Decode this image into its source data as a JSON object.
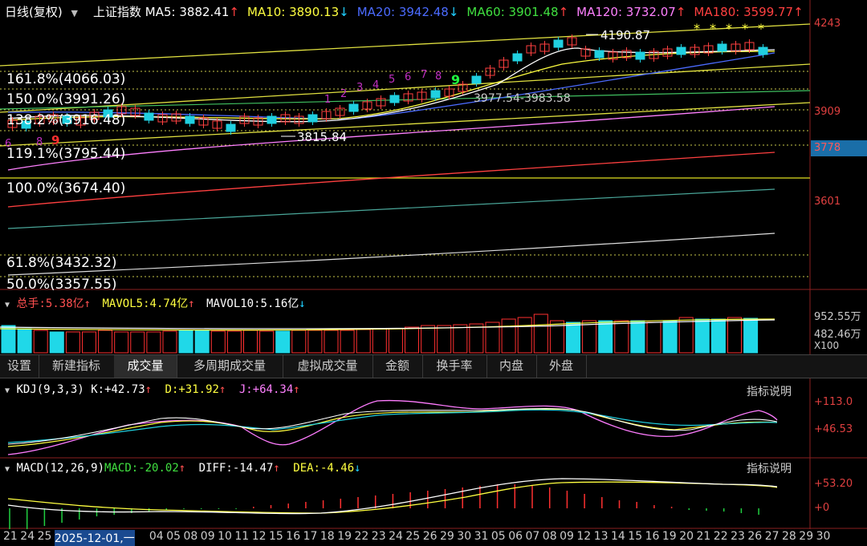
{
  "header": {
    "period": "日线(复权)",
    "dropdown_arrow": "▼",
    "index_name": "上证指数",
    "ma": [
      {
        "label": "MA5:",
        "value": "3882.41",
        "arrow": "↑",
        "color": "#ffffff"
      },
      {
        "label": "MA10:",
        "value": "3890.13",
        "arrow": "↓",
        "color": "#ffff40"
      },
      {
        "label": "MA20:",
        "value": "3942.48",
        "arrow": "↓",
        "color": "#4b6bff"
      },
      {
        "label": "MA60:",
        "value": "3901.48",
        "arrow": "↑",
        "color": "#40e040"
      },
      {
        "label": "MA120:",
        "value": "3732.07",
        "arrow": "↑",
        "color": "#ff80ff"
      },
      {
        "label": "MA180:",
        "value": "3599.77",
        "arrow": "↑",
        "color": "#ff4040"
      }
    ]
  },
  "fib_levels": [
    {
      "label": "161.8%(4066.03)"
    },
    {
      "label": "150.0%(3991.26)"
    },
    {
      "label": "138.2%(3916.48)"
    },
    {
      "label": "119.1%(3795.44)"
    },
    {
      "label": "100.0%(3674.40)"
    },
    {
      "label": "61.8%(3432.32)"
    },
    {
      "label": "50.0%(3357.55)"
    }
  ],
  "price_axis": {
    "top": "4243",
    "mid": "3909",
    "current": "3778",
    "bottom": "3601"
  },
  "annotations": {
    "high": "4190.87",
    "low": "3815.84",
    "gap": "3977.54-3983.58",
    "td_counts": [
      "1",
      "2",
      "3",
      "4",
      "5",
      "6",
      "7",
      "8",
      "9"
    ],
    "left_counts": [
      "6",
      "8",
      "9"
    ],
    "stars": [
      "*",
      "*",
      "*",
      "*",
      "*"
    ]
  },
  "volume": {
    "label": "总手:",
    "total": "5.38亿",
    "total_arrow": "↑",
    "mavol5_label": "MAVOL5:",
    "mavol5": "4.74亿",
    "mavol5_arrow": "↑",
    "mavol10_label": "MAVOL10:",
    "mavol10": "5.16亿",
    "mavol10_arrow": "↓",
    "axis_top": "952.55万",
    "axis_mid": "482.46万",
    "axis_unit": "X100"
  },
  "tabs": [
    {
      "label": "设置"
    },
    {
      "label": "新建指标"
    },
    {
      "label": "成交量"
    },
    {
      "label": "多周期成交量"
    },
    {
      "label": "虚拟成交量"
    },
    {
      "label": "金额"
    },
    {
      "label": "换手率"
    },
    {
      "label": "内盘"
    },
    {
      "label": "外盘"
    }
  ],
  "kdj": {
    "name": "KDJ(9,3,3)",
    "k_label": "K:",
    "k": "+42.73",
    "k_arrow": "↑",
    "d_label": "D:",
    "d": "+31.92",
    "d_arrow": "↑",
    "j_label": "J:",
    "j": "+64.34",
    "j_arrow": "↑",
    "explain": "指标说明",
    "axis_top": "+113.0",
    "axis_bottom": "+46.53"
  },
  "macd": {
    "name": "MACD(12,26,9)",
    "macd_label": "MACD:",
    "macd": "-20.02",
    "macd_arrow": "↑",
    "diff_label": "DIFF:",
    "diff": "-14.47",
    "diff_arrow": "↑",
    "dea_label": "DEA:",
    "dea": "-4.46",
    "dea_arrow": "↓",
    "explain": "指标说明",
    "axis_top": "+53.20",
    "axis_zero": "+0"
  },
  "dates": {
    "ticks": [
      "21",
      "24",
      "25",
      "2025-12-01,一",
      "04",
      "05",
      "08",
      "09",
      "10",
      "11",
      "12",
      "15",
      "16",
      "17",
      "18",
      "19",
      "22",
      "23",
      "24",
      "25",
      "26",
      "29",
      "30",
      "31",
      "05",
      "06",
      "07",
      "08",
      "09",
      "12",
      "13",
      "14",
      "15",
      "16",
      "19",
      "20",
      "21",
      "22",
      "23",
      "26",
      "27",
      "28",
      "29",
      "30"
    ]
  }
}
